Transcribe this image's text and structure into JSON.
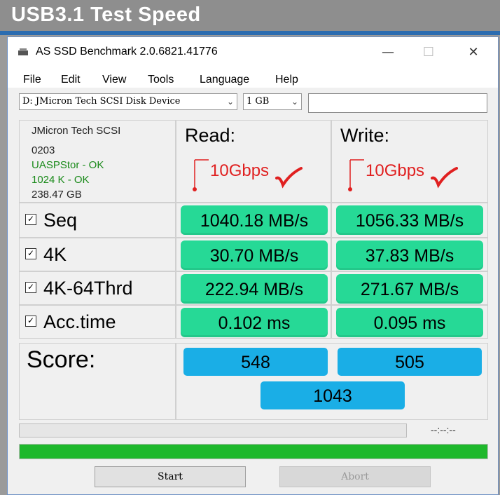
{
  "banner": {
    "title": "USB3.1 Test Speed"
  },
  "window": {
    "title": "AS SSD Benchmark 2.0.6821.41776",
    "controls": {
      "minimize": "—",
      "maximize": "☐",
      "close": "✕"
    }
  },
  "menu": [
    "File",
    "Edit",
    "View",
    "Tools",
    "Language",
    "Help"
  ],
  "toolbar": {
    "drive_select": "D: JMicron Tech SCSI Disk Device",
    "size_select": "1 GB",
    "text_input": ""
  },
  "device_info": {
    "name": "JMicron Tech SCSI",
    "firmware": "0203",
    "driver": "UASPStor - OK",
    "alignment": "1024 K - OK",
    "capacity": "238.47 GB"
  },
  "columns": {
    "read": "Read:",
    "write": "Write:"
  },
  "annotations": {
    "read": "10Gbps",
    "write": "10Gbps"
  },
  "rows": [
    {
      "label": "Seq",
      "read": "1040.18 MB/s",
      "write": "1056.33 MB/s"
    },
    {
      "label": "4K",
      "read": "30.70 MB/s",
      "write": "37.83 MB/s"
    },
    {
      "label": "4K-64Thrd",
      "read": "222.94 MB/s",
      "write": "271.67 MB/s"
    },
    {
      "label": "Acc.time",
      "read": "0.102 ms",
      "write": "0.095 ms"
    }
  ],
  "score": {
    "label": "Score:",
    "read": "548",
    "write": "505",
    "total": "1043"
  },
  "status": {
    "timer": "--:--:--",
    "progress_fraction": 1.0
  },
  "buttons": {
    "start": "Start",
    "abort": "Abort"
  },
  "colors": {
    "result_fill": "#26d996",
    "score_fill": "#1aaee6",
    "progress_fill": "#1eb82c",
    "annotation": "#e02020"
  }
}
